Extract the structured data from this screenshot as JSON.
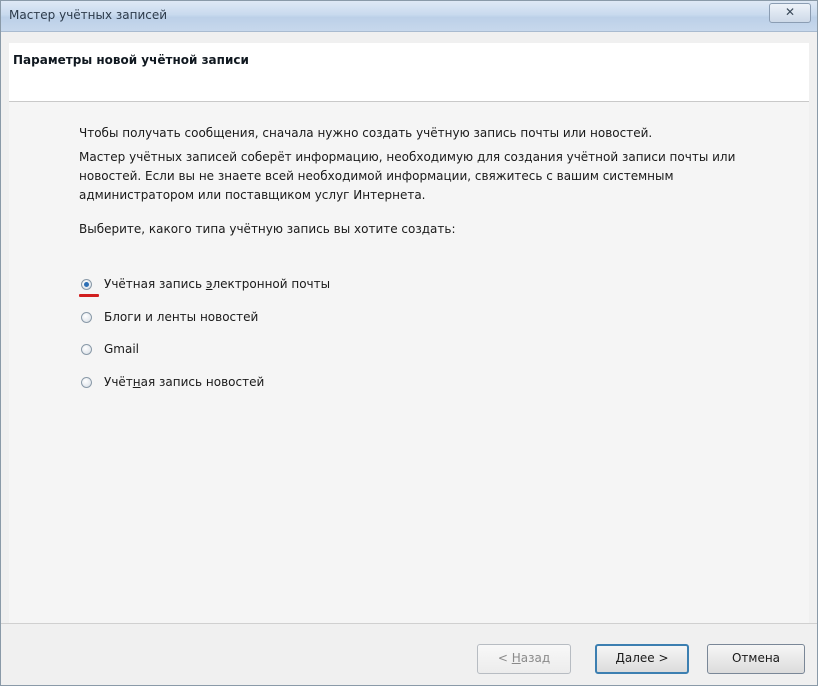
{
  "window": {
    "title": "Мастер учётных записей",
    "close_glyph": "✕"
  },
  "header": {
    "title": "Параметры новой учётной записи"
  },
  "content": {
    "paragraph1": "Чтобы получать сообщения, сначала нужно создать учётную запись почты или новостей.",
    "paragraph2": "Мастер учётных записей соберёт информацию, необходимую для создания учётной записи почты или новостей. Если вы не знаете всей необходимой информации, свяжитесь с вашим системным администратором или поставщиком услуг Интернета.",
    "paragraph3": "Выберите, какого типа учётную запись вы хотите создать:",
    "options": [
      {
        "label_before": "Учётная запись ",
        "label_access": "э",
        "label_after": "лектронной почты",
        "checked": true
      },
      {
        "label_before": "Блоги и ленты новостей",
        "label_access": "",
        "label_after": "",
        "checked": false
      },
      {
        "label_before": "Gmail",
        "label_access": "",
        "label_after": "",
        "checked": false
      },
      {
        "label_before": "Учёт",
        "label_access": "н",
        "label_after": "ая запись новостей",
        "checked": false
      }
    ]
  },
  "footer": {
    "back": {
      "before": "< ",
      "access": "Н",
      "after": "азад"
    },
    "next": {
      "before": "",
      "access": "Д",
      "after": "алее >"
    },
    "cancel": "Отмена"
  },
  "colors": {
    "accent": "#3c7fb1",
    "radio_checked": "#2d6fb5",
    "annotation_red": "#d11f1f"
  },
  "icons": {
    "close": "close-icon",
    "radio": "radio-button-icon"
  }
}
